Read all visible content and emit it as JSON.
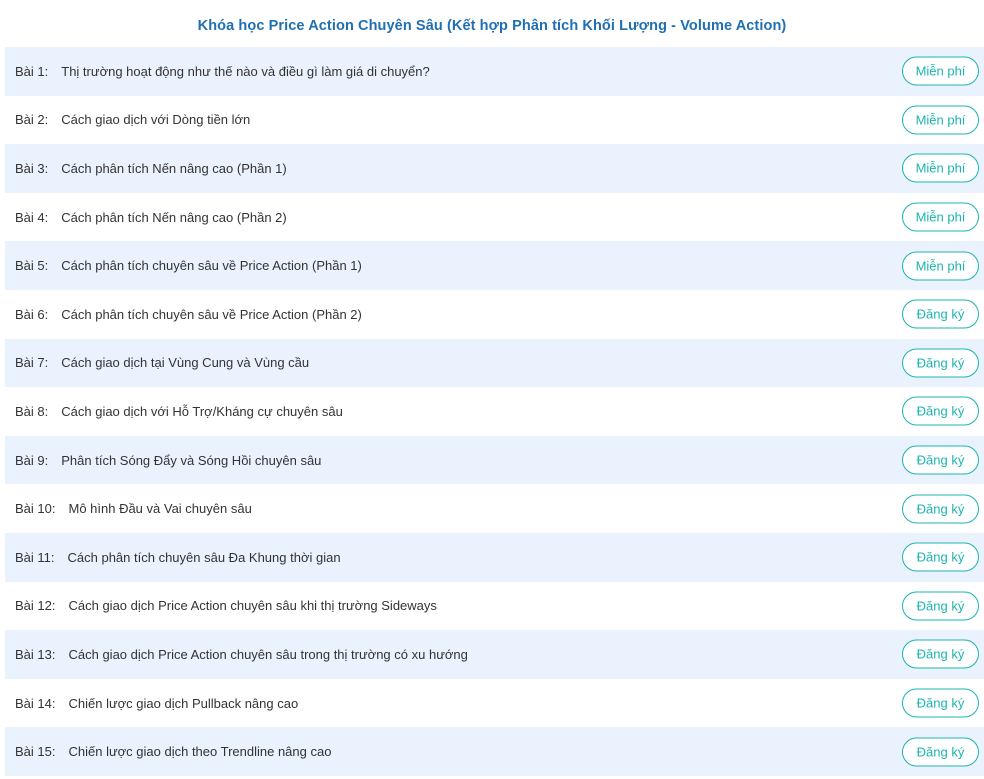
{
  "course": {
    "title": "Khóa học Price Action Chuyên Sâu (Kết hợp Phân tích Khối Lượng - Volume Action)"
  },
  "colors": {
    "title": "#1f6fb2",
    "row_shade": "#e9f2fd",
    "button_accent": "#1bb5b0",
    "text": "#333333"
  },
  "lessons": [
    {
      "num": "Bài 1:",
      "name": "Thị trường hoạt động như thế nào và điều gì làm giá di chuyển?",
      "button": "Miễn phí"
    },
    {
      "num": "Bài 2:",
      "name": "Cách giao dịch với Dòng tiền lớn",
      "button": "Miễn phí"
    },
    {
      "num": "Bài 3:",
      "name": "Cách phân tích Nến nâng cao (Phần 1)",
      "button": "Miễn phí"
    },
    {
      "num": "Bài 4:",
      "name": "Cách phân tích Nến nâng cao (Phần 2)",
      "button": "Miễn phí"
    },
    {
      "num": "Bài 5:",
      "name": "Cách phân tích chuyên sâu về Price Action (Phần 1)",
      "button": "Miễn phí"
    },
    {
      "num": "Bài 6:",
      "name": "Cách phân tích chuyên sâu về Price Action (Phần 2)",
      "button": "Đăng ký"
    },
    {
      "num": "Bài 7:",
      "name": "Cách giao dịch tại Vùng Cung và Vùng cầu",
      "button": "Đăng ký"
    },
    {
      "num": "Bài 8:",
      "name": "Cách giao dịch với Hỗ Trợ/Kháng cự chuyên sâu",
      "button": "Đăng ký"
    },
    {
      "num": "Bài 9:",
      "name": "Phân tích Sóng Đẩy và Sóng Hồi chuyên sâu",
      "button": "Đăng ký"
    },
    {
      "num": "Bài 10:",
      "name": "Mô hình Đầu và Vai chuyên sâu",
      "button": "Đăng ký"
    },
    {
      "num": "Bài 11:",
      "name": "Cách phân tích chuyên sâu Đa Khung thời gian",
      "button": "Đăng ký"
    },
    {
      "num": "Bài 12:",
      "name": "Cách giao dịch Price Action chuyên sâu khi thị trường Sideways",
      "button": "Đăng ký"
    },
    {
      "num": "Bài 13:",
      "name": "Cách giao dịch Price Action chuyên sâu trong thị trường có xu hướng",
      "button": "Đăng ký"
    },
    {
      "num": "Bài 14:",
      "name": "Chiến lược giao dịch Pullback nâng cao",
      "button": "Đăng ký"
    },
    {
      "num": "Bài 15:",
      "name": "Chiến lược giao dịch theo Trendline nâng cao",
      "button": "Đăng ký"
    }
  ]
}
